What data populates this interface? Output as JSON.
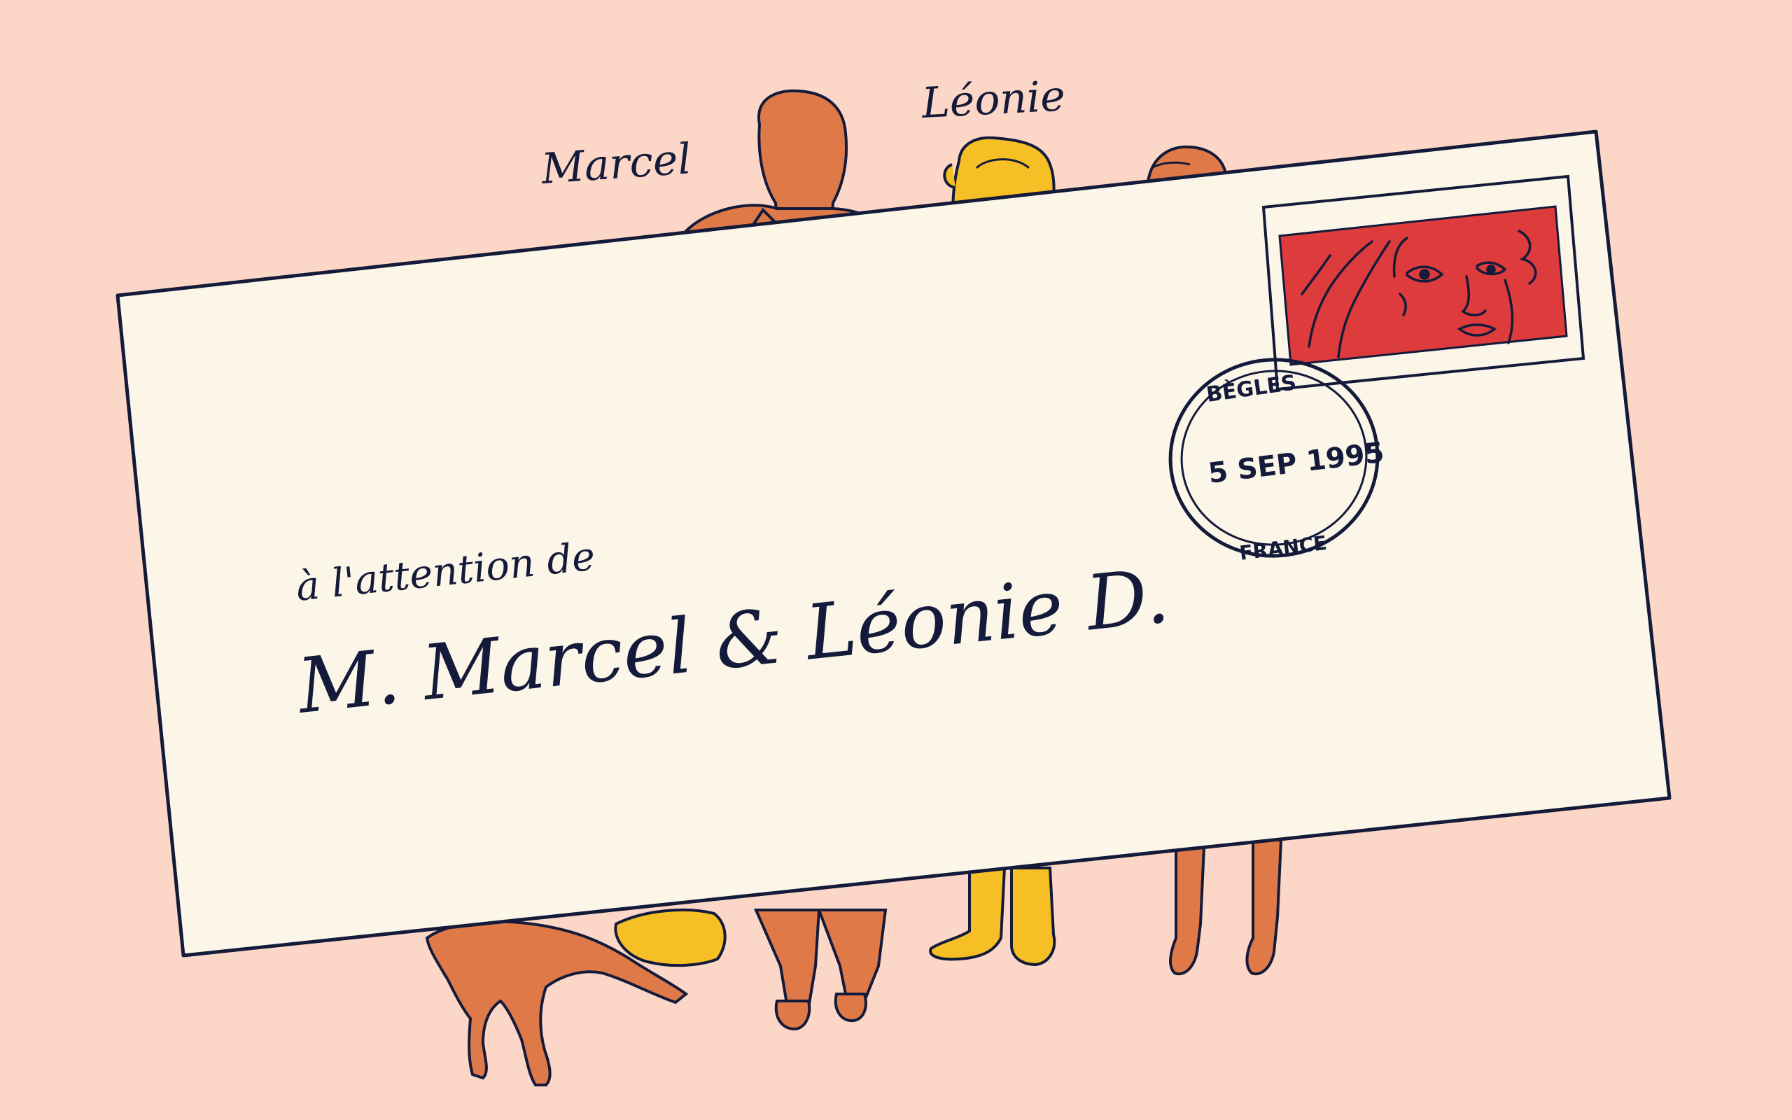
{
  "labels": {
    "name_left": "Marcel",
    "name_right": "Léonie"
  },
  "envelope": {
    "attention_line": "à l'attention de",
    "recipient": "M. Marcel & Léonie D."
  },
  "postmark": {
    "town": "BÈGLES",
    "date": "5 SEP 1995",
    "country": "FRANCE"
  },
  "colors": {
    "background": "#fcd6c6",
    "envelope": "#fbf6e8",
    "ink": "#141a3a",
    "figure_orange": "#df7a48",
    "figure_yellow": "#f5bf25",
    "stamp_red": "#de3b3c"
  }
}
